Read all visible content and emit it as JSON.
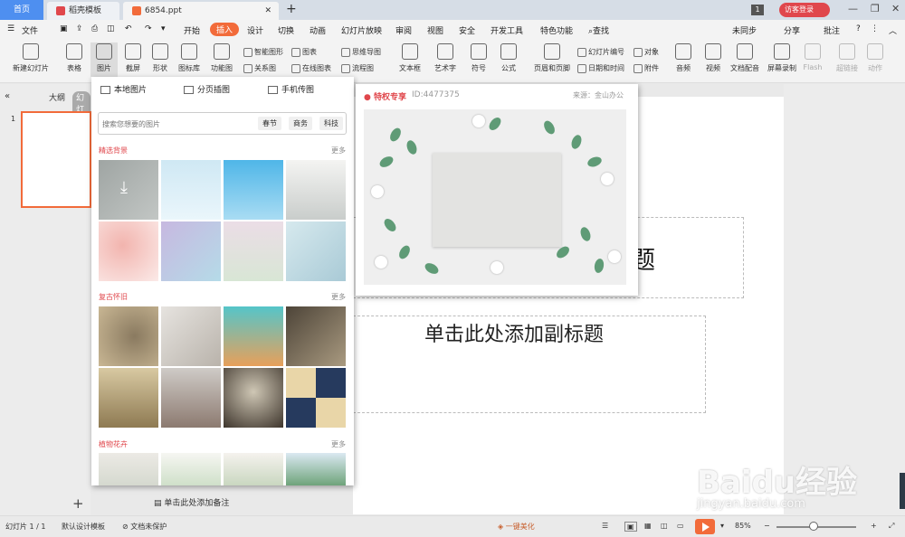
{
  "tabs": {
    "home": "首页",
    "template": "稻壳模板",
    "file": "6854.ppt",
    "page_count": "1",
    "login": "访客登录"
  },
  "menu": [
    "文件",
    "开始",
    "插入",
    "设计",
    "切换",
    "动画",
    "幻灯片放映",
    "审阅",
    "视图",
    "安全",
    "开发工具",
    "特色功能",
    "查找"
  ],
  "menu_right": {
    "sync": "未同步",
    "share": "分享",
    "comment": "批注"
  },
  "ribbon": {
    "big": [
      "新建幻灯片",
      "表格",
      "图片",
      "截屏",
      "形状",
      "图标库",
      "功能图",
      "文本框",
      "艺术字",
      "符号",
      "公式",
      "页眉和页脚",
      "音频",
      "视频",
      "文档配音",
      "屏幕录制",
      "Flash",
      "超链接",
      "动作"
    ],
    "small": [
      "智能图形",
      "图表",
      "思维导图",
      "关系图",
      "在线图表",
      "流程图",
      "幻灯片编号",
      "对象",
      "日期和时间",
      "附件"
    ]
  },
  "left_pane": {
    "outline": "大纲",
    "slides": "幻灯片",
    "slide_number": "1"
  },
  "picture_panel": {
    "options": [
      "本地图片",
      "分页插图",
      "手机传图"
    ],
    "search_placeholder": "搜索您想要的图片",
    "tags": [
      "春节",
      "商务",
      "科技"
    ],
    "sections": [
      "精选背景",
      "复古怀旧",
      "植物花卉"
    ],
    "more": "更多"
  },
  "preview": {
    "badge": "特权专享",
    "id": "ID:4477375",
    "source": "来源：金山办公"
  },
  "canvas": {
    "title_fragment": "题",
    "subtitle": "单击此处添加副标题"
  },
  "notes": "单击此处添加备注",
  "status": {
    "slide": "幻灯片 1 / 1",
    "template": "默认设计模板",
    "protect": "文档未保护",
    "beautify": "一键美化",
    "zoom": "85%"
  },
  "watermark": {
    "brand": "Baidu经验",
    "url": "jingyan.baidu.com"
  },
  "colors": {
    "accent": "#f26b3a",
    "brand": "#e0474c",
    "tab_blue": "#4e8ff0"
  }
}
